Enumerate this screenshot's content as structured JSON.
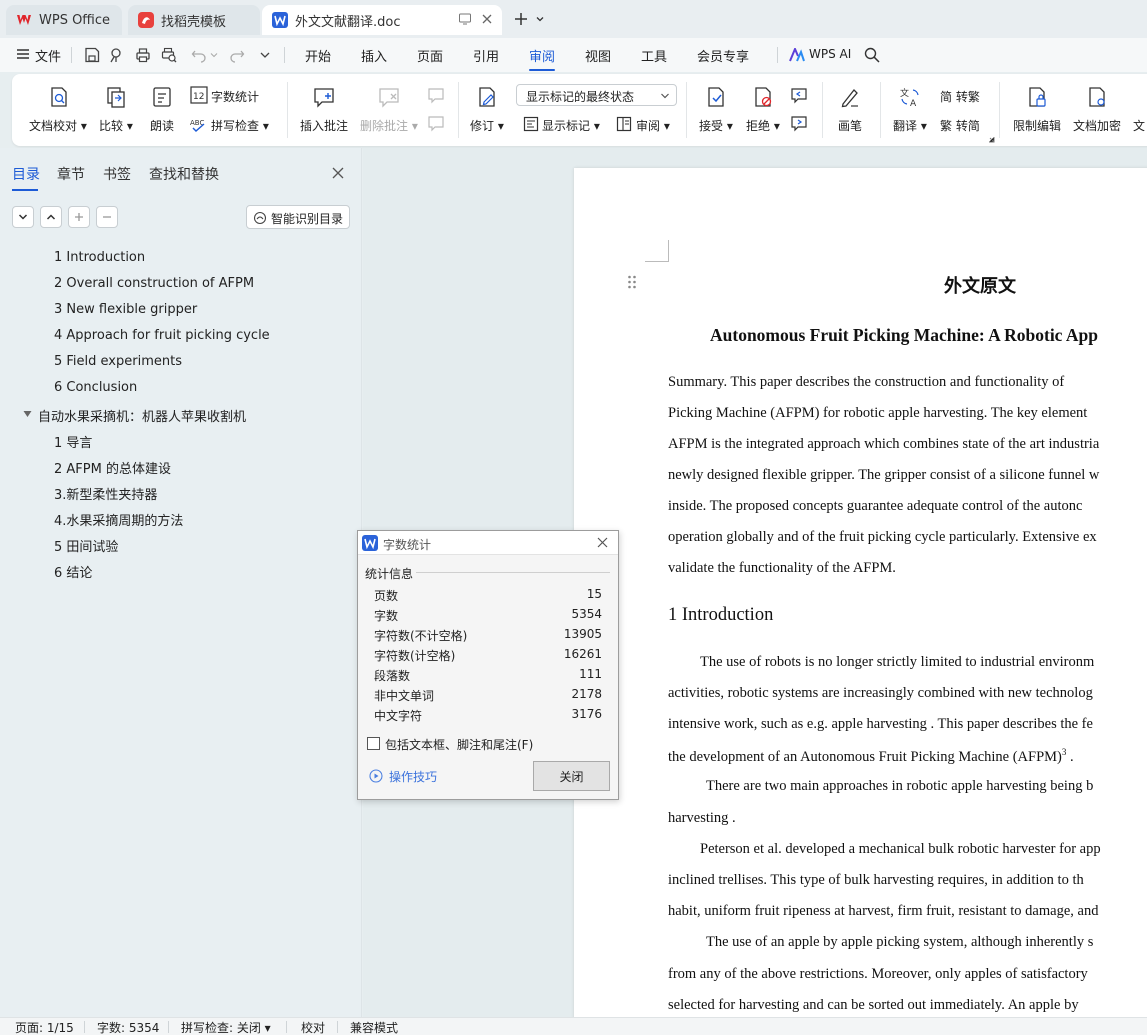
{
  "tabs": [
    {
      "label": "WPS Office"
    },
    {
      "label": "找稻壳模板"
    },
    {
      "label": "外文文献翻译.doc"
    }
  ],
  "menu": {
    "file": "文件",
    "items": [
      "开始",
      "插入",
      "页面",
      "引用",
      "审阅",
      "视图",
      "工具",
      "会员专享"
    ],
    "active": "审阅",
    "wps_ai": "WPS AI"
  },
  "ribbon": {
    "doc_check": "文档校对",
    "compare": "比较",
    "read_aloud": "朗读",
    "word_count": "字数统计",
    "spell_check": "拼写检查",
    "insert_comment": "插入批注",
    "delete_comment": "删除批注",
    "revise": "修订",
    "markup_state": "显示标记的最终状态",
    "show_markup": "显示标记",
    "review_pane": "审阅",
    "accept": "接受",
    "reject": "拒绝",
    "pen": "画笔",
    "translate": "翻译",
    "to_traditional": "简 转繁",
    "to_simplified": "繁 转简",
    "restrict_edit": "限制编辑",
    "doc_encrypt": "文档加密",
    "cut_label": "文"
  },
  "sidebar": {
    "tabs": [
      "目录",
      "章节",
      "书签",
      "查找和替换"
    ],
    "smart_toc": "智能识别目录",
    "toc": [
      {
        "label": "1 Introduction",
        "level": 2
      },
      {
        "label": "2 Overall construction of AFPM",
        "level": 2
      },
      {
        "label": "3 New flexible gripper",
        "level": 2
      },
      {
        "label": "4 Approach for fruit picking cycle",
        "level": 2
      },
      {
        "label": "5 Field experiments",
        "level": 2
      },
      {
        "label": "6 Conclusion",
        "level": 2
      },
      {
        "label": "自动水果采摘机：机器人苹果收割机",
        "level": 1
      },
      {
        "label": "1 导言",
        "level": 2
      },
      {
        "label": "2 AFPM 的总体建设",
        "level": 2
      },
      {
        "label": "3.新型柔性夹持器",
        "level": 2
      },
      {
        "label": "4.水果采摘周期的方法",
        "level": 2
      },
      {
        "label": "5 田间试验",
        "level": 2
      },
      {
        "label": "6 结论",
        "level": 2
      }
    ]
  },
  "document": {
    "heading_cn": "外文原文",
    "title": "Autonomous Fruit Picking Machine: A Robotic App",
    "lines": [
      "Summary.  This  paper  describes  the  construction  and  functionality  of",
      "Picking  Machine  (AFPM)  for  robotic  apple  harvesting.  The  key  element",
      "AFPM  is  the  integrated  approach  which  combines  state  of  the  art  industria",
      "newly  designed  flexible  gripper.  The  gripper  consist  of  a  silicone  funnel  w",
      "inside.  The  proposed  concepts  guarantee  adequate  control  of  the  autonc",
      "operation  globally  and  of  the  fruit  picking   cycle  particularly.  Extensive  ex",
      "validate the functionality of the AFPM."
    ],
    "section_heading": "1 Introduction",
    "body_lines": [
      "The  use  of  robots  is  no  longer  strictly  limited  to  industrial  environm",
      "activities,  robotic  systems  are  increasingly  combined  with  new  technolog",
      "intensive  work,  such  as  e.g.  apple  harvesting  .  This  paper  describes  the  fe",
      "the development of an Autonomous Fruit Picking Machine (AFPM)",
      "There  are  two  main  approaches  in  robotic  apple  harvesting  being  b",
      "harvesting .",
      "Peterson  et al.  developed  a  mechanical  bulk  robotic  harvester  for  app",
      "inclined  trellises.  This  type  of  bulk  harvesting  requires,  in  addition  to  th",
      "habit, uniform fruit ripeness at harvest, firm fruit, resistant to damage, and",
      "The  use  of  an  apple  by  apple  picking  system,  although  inherently  s",
      "from  any  of  the  above  restrictions.  Moreover,  only  apples  of  satisfactory",
      "selected  for  harvesting  and  can  be  sorted  out  immediately.  An  apple  by"
    ],
    "superscript": "3",
    "after_superscript": " ."
  },
  "dialog": {
    "title": "字数统计",
    "section": "统计信息",
    "stats": [
      {
        "label": "页数",
        "value": "15"
      },
      {
        "label": "字数",
        "value": "5354"
      },
      {
        "label": "字符数(不计空格)",
        "value": "13905"
      },
      {
        "label": "字符数(计空格)",
        "value": "16261"
      },
      {
        "label": "段落数",
        "value": "111"
      },
      {
        "label": "非中文单词",
        "value": "2178"
      },
      {
        "label": "中文字符",
        "value": "3176"
      }
    ],
    "checkbox_label": "包括文本框、脚注和尾注(F)",
    "tips": "操作技巧",
    "close": "关闭"
  },
  "status": {
    "page": "页面: 1/15",
    "words": "字数: 5354",
    "spell": "拼写检查: 关闭",
    "proof": "校对",
    "compat": "兼容模式"
  },
  "colors": {
    "accent": "#1d5bd6",
    "wps_red": "#e0262c",
    "doc_blue": "#2b63d9"
  }
}
